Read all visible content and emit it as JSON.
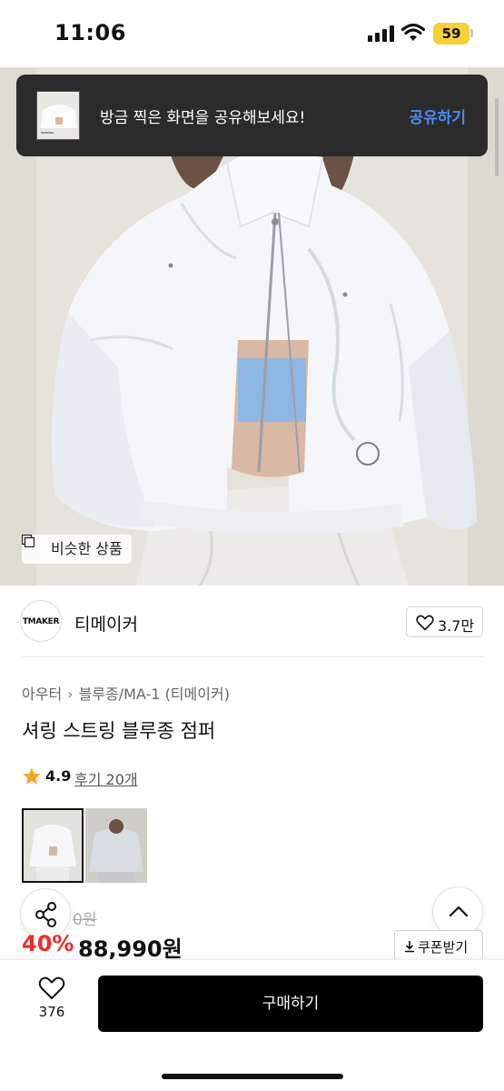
{
  "status_bar": {
    "time": "11:06",
    "battery": "59"
  },
  "toast": {
    "message": "방금 찍은 화면을 공유해보세요!",
    "action": "공유하기"
  },
  "hero": {
    "similar_label": "비슷한 상품"
  },
  "brand": {
    "logo_text": "TMAKER",
    "name": "티메이커",
    "likes": "3.7만"
  },
  "breadcrumb": {
    "category": "아우터",
    "subcategory": "블루종/MA-1 (티메이커)"
  },
  "product": {
    "title": "셔링 스트링 블루종 점퍼",
    "rating": "4.9",
    "reviews": "후기 20개",
    "original_price": "0원",
    "discount": "40%",
    "price": "88,990원"
  },
  "coupon": {
    "label": "쿠폰받기"
  },
  "bottom": {
    "wish_count": "376",
    "buy_label": "구매하기"
  },
  "colors": {
    "accent_blue": "#4a8bf5",
    "discount_red": "#e8312f",
    "star": "#f5a623",
    "battery": "#f7d038"
  }
}
